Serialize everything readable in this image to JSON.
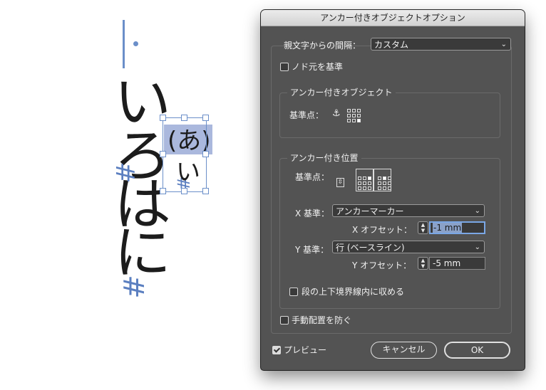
{
  "canvas": {
    "vertical_text": [
      "い",
      "ろ",
      "は",
      "に"
    ],
    "anchored_text_1": "(あ)",
    "anchored_text_2": "い",
    "hash_mark": "#"
  },
  "dialog": {
    "title": "アンカー付きオブジェクトオプション",
    "parent_spacing_label": "親文字からの間隔：",
    "parent_spacing_value": "カスタム",
    "node_base_label": "ノド元を基準",
    "anchored_object_group": "アンカー付きオブジェクト",
    "reference_point_label": "基準点：",
    "anchor_icon": "anchor-icon",
    "anchor_position_group": "アンカー付き位置",
    "anchor_reference_point_label": "基準点：",
    "x_base_label": "X 基準：",
    "x_base_value": "アンカーマーカー",
    "x_offset_label": "X オフセット：",
    "x_offset_value": "-1 mm",
    "y_base_label": "Y 基準：",
    "y_base_value": "行 (ベースライン)",
    "y_offset_label": "Y オフセット：",
    "y_offset_value": "-5 mm",
    "keep_within_label": "段の上下境界線内に収める",
    "prevent_manual_label": "手動配置を防ぐ",
    "preview_label": "プレビュー",
    "cancel_label": "キャンセル",
    "ok_label": "OK",
    "chevron_icon": "chevron-down-icon",
    "accent_color": "#7aa7e6",
    "dialog_bg": "#535353"
  }
}
